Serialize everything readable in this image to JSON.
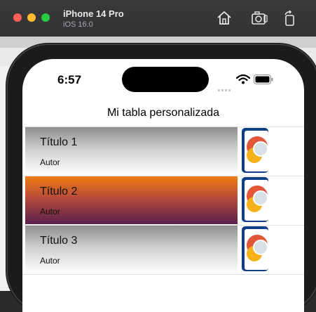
{
  "window": {
    "title": "iPhone 14 Pro",
    "subtitle": "iOS 16.0",
    "buttons": [
      "home-icon",
      "screenshot-icon",
      "rotate-icon"
    ]
  },
  "status_bar": {
    "time": "6:57"
  },
  "nav": {
    "title": "Mi tabla personalizada"
  },
  "rows": [
    {
      "title": "Título 1",
      "author": "Autor",
      "style": "gray"
    },
    {
      "title": "Título 2",
      "author": "Autor",
      "style": "orange"
    },
    {
      "title": "Título 3",
      "author": "Autor",
      "style": "gray"
    }
  ],
  "colors": {
    "close": "#ff5f57",
    "minimize": "#febc2e",
    "maximize": "#28c840",
    "thumb_frame": "#0f3f84"
  }
}
